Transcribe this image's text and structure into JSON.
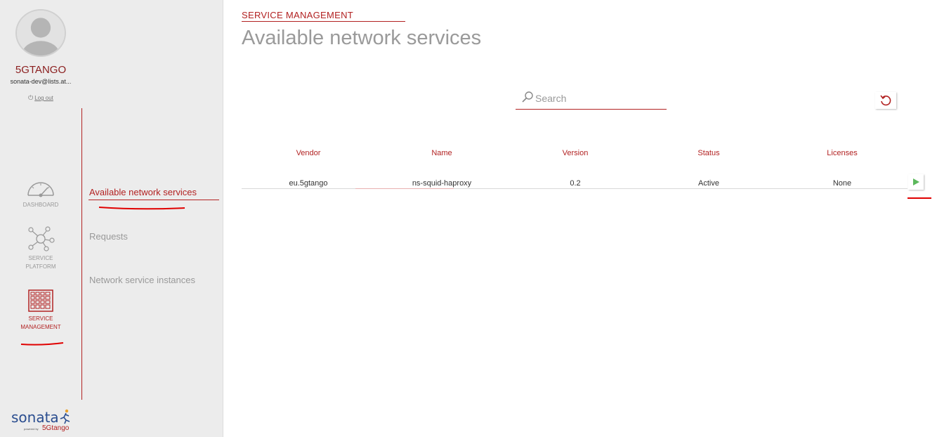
{
  "profile": {
    "name": "5GTANGO",
    "email": "sonata-dev@lists.at...",
    "logout_label": "Log out"
  },
  "nav": {
    "dashboard_label": "DASHBOARD",
    "service_platform_line1": "SERVICE",
    "service_platform_line2": "PLATFORM",
    "service_management_line1": "SERVICE",
    "service_management_line2": "MANAGEMENT"
  },
  "submenu": {
    "items": [
      {
        "label": "Available network services"
      },
      {
        "label": "Requests"
      },
      {
        "label": "Network service instances"
      }
    ]
  },
  "logo": {
    "brand": "sonata",
    "powered_by": "powered by",
    "partner": "5Gtango"
  },
  "main": {
    "breadcrumb": "SERVICE MANAGEMENT",
    "title": "Available network services",
    "search_placeholder": "Search",
    "table": {
      "headers": [
        "Vendor",
        "Name",
        "Version",
        "Status",
        "Licenses"
      ],
      "rows": [
        [
          "eu.5gtango",
          "ns-squid-haproxy",
          "0.2",
          "Active",
          "None"
        ]
      ]
    }
  },
  "colors": {
    "accent": "#b22222",
    "rail_bg": "#ececec",
    "play": "#5cb85c"
  },
  "icons": {
    "search": "search-icon",
    "refresh": "refresh-icon",
    "play": "play-icon",
    "dashboard": "gauge-icon",
    "platform": "network-hub-icon",
    "service": "grid-icon",
    "power": "power-icon"
  }
}
